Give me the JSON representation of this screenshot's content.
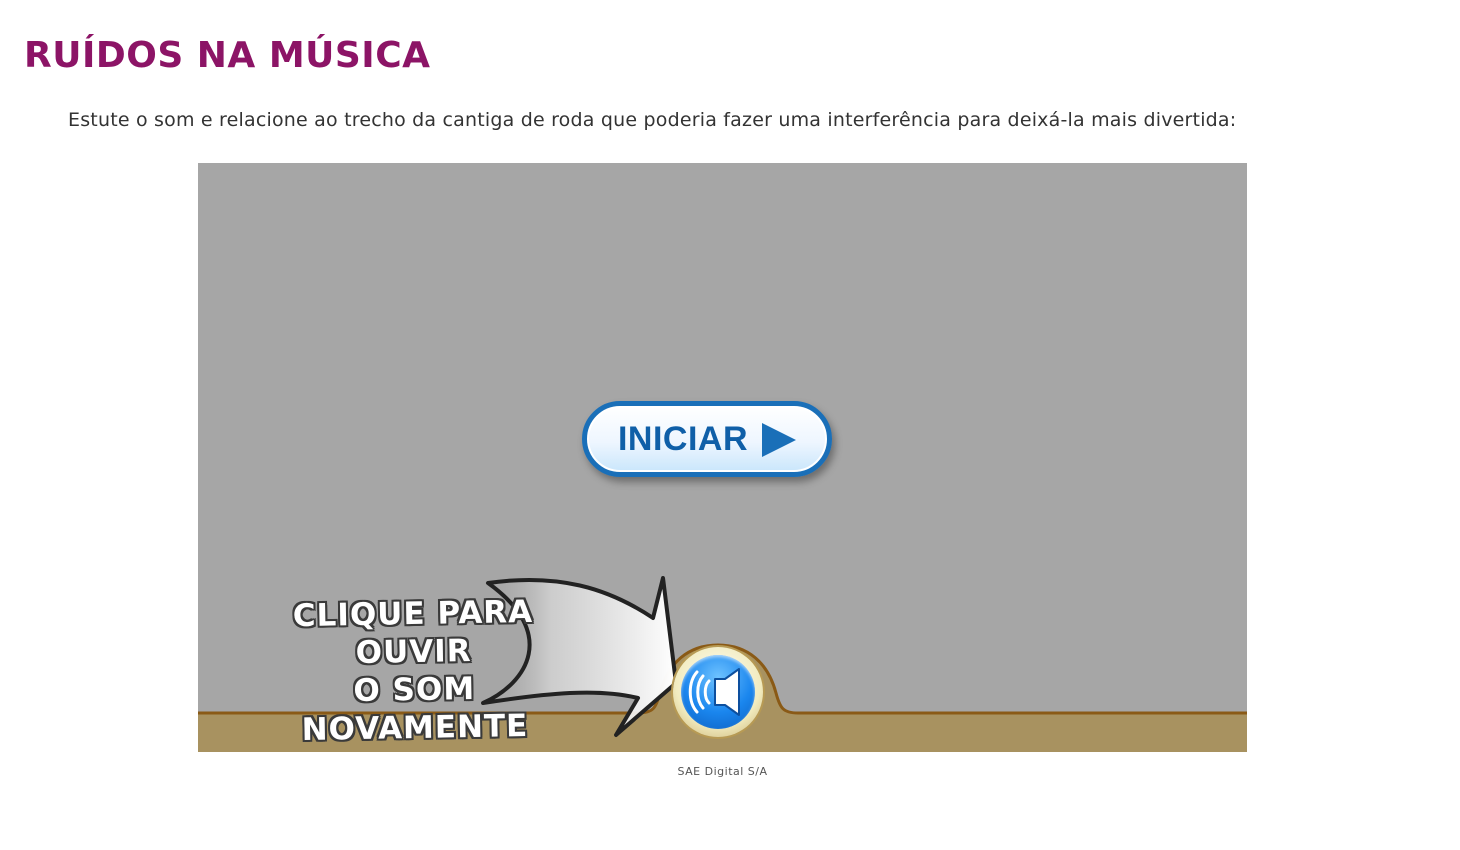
{
  "page": {
    "title": "RUÍDOS NA MÚSICA",
    "instructions": "Estute o som e relacione ao trecho da cantiga de roda que poderia fazer uma interferência para deixá-la mais divertida:"
  },
  "activity": {
    "start_button_label": "INICIAR",
    "hint_line_1": "CLIQUE PARA OUVIR",
    "hint_line_2": "O SOM NOVAMENTE",
    "colors": {
      "stage_background": "#a6a6a6",
      "floor": "#a89260",
      "floor_edge": "#8a5a16",
      "title": "#8c1466",
      "button_border": "#1a6fb8"
    },
    "icons": {
      "start": "play-triangle-icon",
      "sound": "speaker-icon",
      "pointer": "arrow-pointer-icon"
    }
  },
  "credit": "SAE Digital S/A"
}
